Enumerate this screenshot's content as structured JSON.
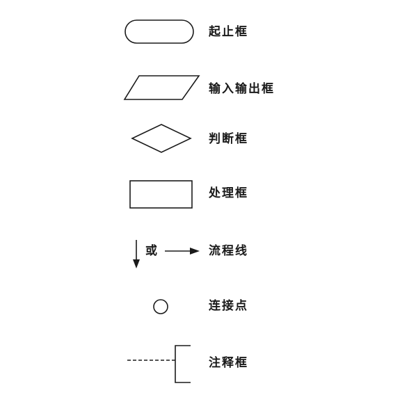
{
  "legend": [
    {
      "symbol": "rounded-rectangle",
      "label": "起止框"
    },
    {
      "symbol": "parallelogram",
      "label": "输入输出框"
    },
    {
      "symbol": "diamond",
      "label": "判断框"
    },
    {
      "symbol": "rectangle",
      "label": "处理框"
    },
    {
      "symbol": "arrows",
      "label": "流程线",
      "connector": "或"
    },
    {
      "symbol": "circle",
      "label": "连接点"
    },
    {
      "symbol": "bracket-with-dashed-line",
      "label": "注释框"
    }
  ]
}
